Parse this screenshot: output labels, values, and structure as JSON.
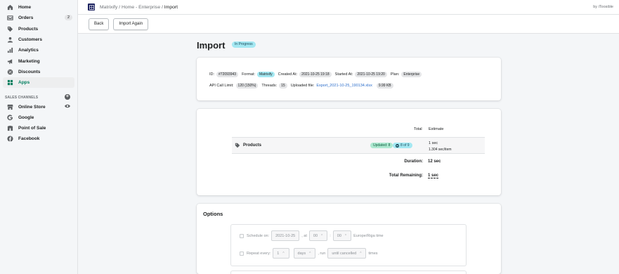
{
  "sidebar": {
    "items": [
      {
        "label": "Home",
        "icon": "home-icon"
      },
      {
        "label": "Orders",
        "icon": "orders-icon",
        "badge": "2"
      },
      {
        "label": "Products",
        "icon": "tag-icon"
      },
      {
        "label": "Customers",
        "icon": "person-icon"
      },
      {
        "label": "Analytics",
        "icon": "bar-chart-icon"
      },
      {
        "label": "Marketing",
        "icon": "megaphone-icon"
      },
      {
        "label": "Discounts",
        "icon": "discount-icon"
      },
      {
        "label": "Apps",
        "icon": "apps-icon",
        "active": true
      }
    ],
    "sales_channels_title": "SALES CHANNELS",
    "channels": [
      {
        "label": "Online Store",
        "icon": "store-icon"
      },
      {
        "label": "Google",
        "icon": "google-icon"
      },
      {
        "label": "Point of Sale",
        "icon": "pos-icon"
      },
      {
        "label": "Facebook",
        "icon": "facebook-icon"
      }
    ]
  },
  "topbar": {
    "breadcrumb_prefix": "Matrixify / Home - Enterprise / ",
    "breadcrumb_current": "Import",
    "byline": "by iToosible"
  },
  "actions": {
    "back": "Back",
    "import_again": "Import Again"
  },
  "page": {
    "title": "Import",
    "status": "In Progress"
  },
  "meta": {
    "id_label": "ID:",
    "id": "#72093943",
    "format_label": "Format:",
    "format": "Matrixify",
    "created_label": "Created At:",
    "created": "2021-10-25 19:18",
    "started_label": "Started At:",
    "started": "2021-10-25 19:20",
    "plan_label": "Plan:",
    "plan": "Enterprise",
    "api_label": "API Call Limit:",
    "api": "120 (150%)",
    "threads_label": "Threads:",
    "threads": "15",
    "file_label": "Uploaded file:",
    "file": "Export_2021-10-25_190134.xlsx",
    "file_size": "9.99 KB"
  },
  "progress": {
    "col_total": "Total",
    "col_estimate": "Estimate",
    "row": {
      "name": "Products",
      "updated": "Updated: 8",
      "progress": "8 of 9",
      "estimate": "1 sec",
      "rate": "1.304 sec/item"
    },
    "duration_label": "Duration:",
    "duration": "12 sec",
    "remaining_label": "Total Remaining:",
    "remaining": "1 sec"
  },
  "options": {
    "title": "Options",
    "schedule_label": "Schedule on:",
    "schedule_date": "2021-10-25",
    "at_label": ", at",
    "hour": "00",
    "minute": "00",
    "timezone": "Europe/Riga time",
    "repeat_label": "Repeat every:",
    "repeat_n": "1",
    "repeat_unit": "days",
    "run_label": ", run",
    "run_mode": "until cancelled",
    "times_label": "times"
  }
}
